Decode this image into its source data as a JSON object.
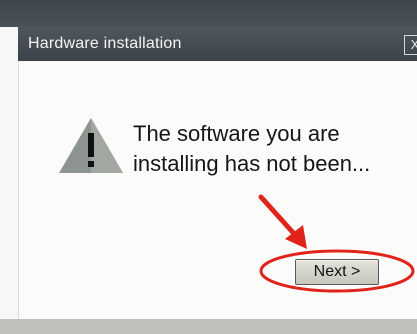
{
  "window": {
    "title": "Hardware installation",
    "close_glyph": "X"
  },
  "dialog": {
    "message_line1": "The software you are",
    "message_line2": "installing has not been...",
    "icon": "warning-icon",
    "annotation_icons": [
      "red-arrow-icon",
      "red-circle-highlight"
    ]
  },
  "buttons": {
    "next_label": "Next >"
  },
  "colors": {
    "title_bar": "#454c53",
    "dialog_bg": "#fbfbf9",
    "annotation_red": "#e0241b",
    "warning_triangle": "#8e948f"
  }
}
